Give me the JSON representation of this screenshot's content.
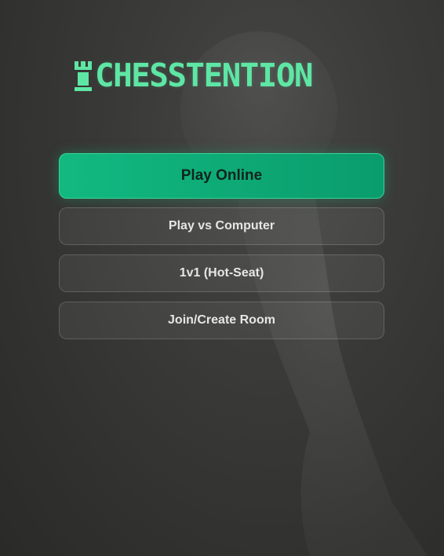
{
  "app": {
    "title": "CHESSTENTION",
    "accent_color": "#10b981",
    "logo_color": "#5ee6a4",
    "background_color": "#3a3a38"
  },
  "logo": {
    "icon": "rook-icon",
    "text": "CHESSTENTION"
  },
  "menu": {
    "play_online_label": "Play Online",
    "play_vs_computer_label": "Play vs Computer",
    "hot_seat_label": "1v1 (Hot-Seat)",
    "join_create_room_label": "Join/Create Room"
  },
  "background": {
    "icon": "pawn-silhouette-icon"
  }
}
